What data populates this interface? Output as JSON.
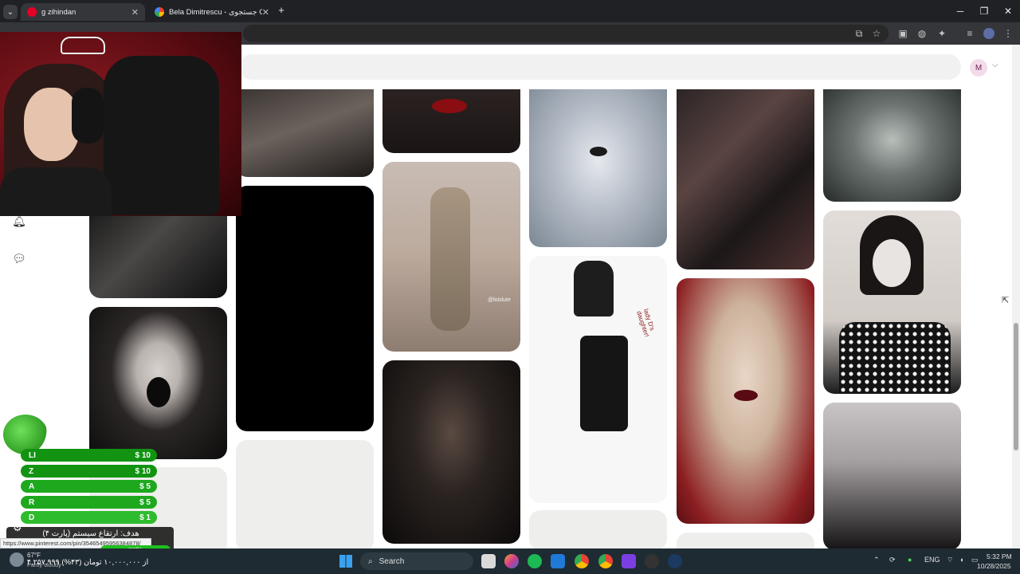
{
  "browser": {
    "tabs": [
      {
        "title": "g zihindan",
        "favicon": "pinterest-icon",
        "active": true
      },
      {
        "title": "Bela Dimitrescu - جستجوی Goo",
        "favicon": "google-icon",
        "active": false
      }
    ],
    "new_tab_label": "+"
  },
  "pinterest": {
    "avatar_initial": "M",
    "status_url": "https://www.pinterest.com/pin/35465495956384878/",
    "pins": [
      {
        "id": "pin-scarred-face",
        "kind": "image"
      },
      {
        "id": "pin-vampire-lips",
        "kind": "image"
      },
      {
        "id": "pin-silver-queen",
        "kind": "image"
      },
      {
        "id": "pin-costume-collage",
        "kind": "image"
      },
      {
        "id": "pin-hooded-witch",
        "kind": "image"
      },
      {
        "id": "pin-dark-hands",
        "kind": "image"
      },
      {
        "id": "pin-black-tile",
        "kind": "image"
      },
      {
        "id": "pin-mirror-selfie",
        "kind": "image",
        "watermark": "@loislute"
      },
      {
        "id": "pin-lady-d-moodboard",
        "kind": "image",
        "caption": "lady D's daughter!"
      },
      {
        "id": "pin-coraline-doll",
        "kind": "image"
      },
      {
        "id": "pin-black-tears",
        "kind": "image"
      },
      {
        "id": "pin-clown-makeup",
        "kind": "image"
      },
      {
        "id": "pin-dark-angel",
        "kind": "image"
      },
      {
        "id": "pin-pigtail-goth",
        "kind": "image"
      }
    ]
  },
  "stream_overlay": {
    "donors": [
      {
        "name": "LI",
        "amount": "$ 10",
        "color": "#129312"
      },
      {
        "name": "Z",
        "amount": "$ 10",
        "color": "#129312"
      },
      {
        "name": "A",
        "amount": "$ 5",
        "color": "#1ea81e"
      },
      {
        "name": "R",
        "amount": "$ 5",
        "color": "#1ea81e"
      },
      {
        "name": "D",
        "amount": "$ 1",
        "color": "#2ebc2e"
      }
    ],
    "goal_title": "هدف: ارتقاع سیستم (پارت ۴)",
    "goal_percent": "۴۳%",
    "goal_progress": 0.43,
    "goal_amount": "۴,۲۵۷,۹۹۹ از ۱۰,۰۰۰,۰۰۰ تومان (۴۳%)"
  },
  "taskbar": {
    "weather_temp": "67°F",
    "weather_desc": "Partly cloudy",
    "search_label": "Search",
    "language": "ENG",
    "time": "5:32 PM",
    "date": "10/28/2025"
  }
}
